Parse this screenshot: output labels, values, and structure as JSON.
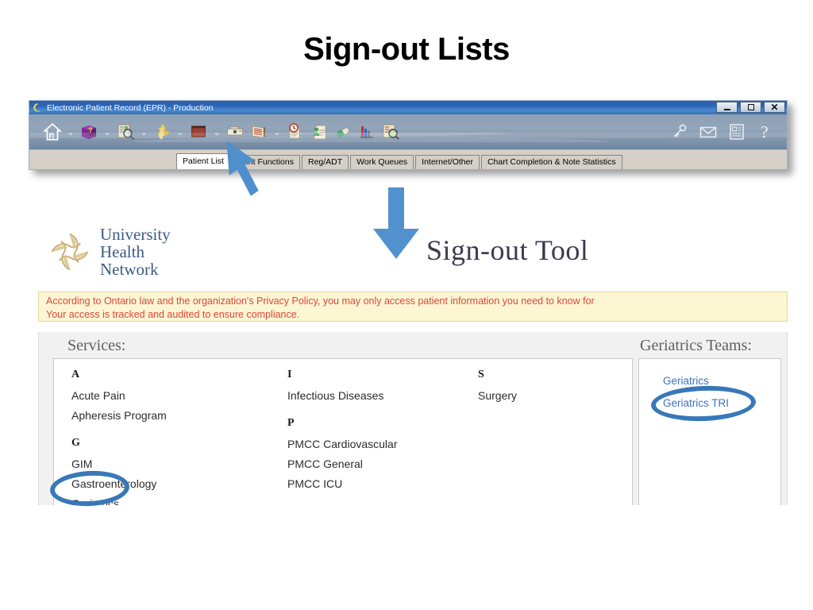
{
  "slide": {
    "title": "Sign-out Lists"
  },
  "epr_window": {
    "title": "Electronic Patient Record (EPR) - Production",
    "title_icon": "epr-swirl-icon",
    "window_buttons": [
      {
        "name": "minimize-button",
        "label": "_"
      },
      {
        "name": "maximize-button",
        "label": "□"
      },
      {
        "name": "close-button",
        "label": "✕"
      }
    ],
    "toolbar": {
      "left_items": [
        {
          "icon": "home-icon",
          "caret": true
        },
        {
          "icon": "purple-help-book-icon",
          "caret": true
        },
        {
          "icon": "chart-search-icon",
          "caret": true
        },
        {
          "icon": "uhn-swirl-icon",
          "caret": true
        },
        {
          "icon": "file-cabinet-icon",
          "caret": true
        },
        {
          "icon": "scanner-icon",
          "caret": false
        },
        {
          "icon": "ledger-book-icon",
          "caret": true
        },
        {
          "icon": "clock-documents-icon",
          "caret": false
        },
        {
          "icon": "patient-record-icon",
          "caret": false
        },
        {
          "icon": "pill-capsule-icon",
          "caret": false
        },
        {
          "icon": "lab-results-icon",
          "caret": false
        },
        {
          "icon": "document-search-icon",
          "caret": false
        }
      ],
      "right_items": [
        {
          "icon": "key-icon"
        },
        {
          "icon": "envelope-icon"
        },
        {
          "icon": "id-card-icon"
        },
        {
          "icon": "question-mark-icon"
        }
      ],
      "caret_glyph": "⌄"
    },
    "tabs": [
      {
        "label": "Patient List",
        "active": true
      },
      {
        "label": "Print Functions",
        "active": false
      },
      {
        "label": "Reg/ADT",
        "active": false
      },
      {
        "label": "Work Queues",
        "active": false
      },
      {
        "label": "Internet/Other",
        "active": false
      },
      {
        "label": "Chart Completion & Note Statistics",
        "active": false
      }
    ]
  },
  "annotations": {
    "arrow_up": "blue-arrow-pointing-to-toolbar",
    "arrow_down": "blue-arrow-pointing-to-signout-tool",
    "ellipse_geriatrics": "blue-ellipse-around-geriatrics",
    "ellipse_geriatrics_tri": "blue-ellipse-around-geriatrics-tri",
    "accent_color": "#3878b8"
  },
  "logo": {
    "line1": "University",
    "line2": "Health",
    "line3": "Network",
    "mark": "uhn-swirl-logo-icon"
  },
  "signout_tool": {
    "heading": "Sign-out Tool"
  },
  "privacy_banner": {
    "line1": "According to Ontario law and the organization's Privacy Policy, you may only access patient information you need to know for",
    "line2": "Your access is tracked and audited to ensure compliance.",
    "text_color": "#e0453c",
    "background_color": "#fdf6d3"
  },
  "services": {
    "heading": "Services:",
    "columns": [
      {
        "groups": [
          {
            "letter": "A",
            "items": [
              "Acute Pain",
              "Apheresis Program"
            ]
          },
          {
            "letter": "G",
            "items": [
              "GIM",
              "Gastroenterology",
              "Geriatrics"
            ]
          }
        ]
      },
      {
        "groups": [
          {
            "letter": "I",
            "items": [
              "Infectious Diseases"
            ]
          },
          {
            "letter": "P",
            "items": [
              "PMCC Cardiovascular",
              "PMCC General",
              "PMCC ICU"
            ]
          }
        ]
      },
      {
        "groups": [
          {
            "letter": "S",
            "items": [
              "Surgery"
            ]
          }
        ]
      }
    ]
  },
  "teams": {
    "heading": "Geriatrics Teams:",
    "items": [
      "Geriatrics",
      "Geriatrics TRI"
    ]
  }
}
